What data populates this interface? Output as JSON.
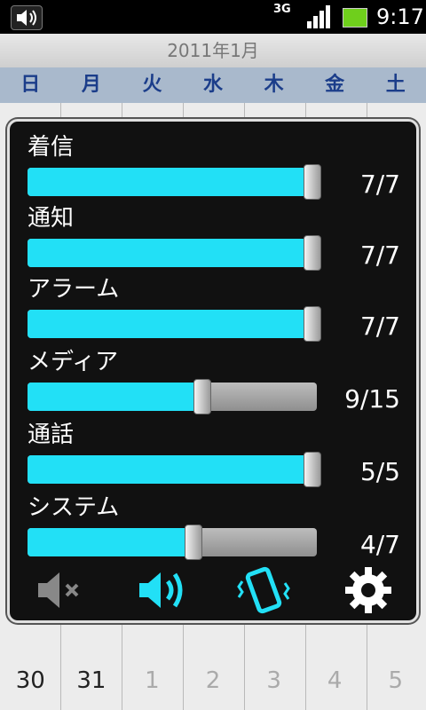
{
  "status": {
    "network": "3G",
    "time": "9:17"
  },
  "calendar": {
    "month_title": "2011年1月",
    "weekdays": [
      "日",
      "月",
      "火",
      "水",
      "木",
      "金",
      "土"
    ],
    "bottom_dates": [
      "30",
      "31",
      "1",
      "2",
      "3",
      "4",
      "5"
    ]
  },
  "volume_panel": {
    "rows": [
      {
        "label": "着信",
        "value_text": "7/7",
        "fraction": 1.0
      },
      {
        "label": "通知",
        "value_text": "7/7",
        "fraction": 1.0
      },
      {
        "label": "アラーム",
        "value_text": "7/7",
        "fraction": 1.0
      },
      {
        "label": "メディア",
        "value_text": "9/15",
        "fraction": 0.6
      },
      {
        "label": "通話",
        "value_text": "5/5",
        "fraction": 1.0
      },
      {
        "label": "システム",
        "value_text": "4/7",
        "fraction": 0.5714
      }
    ],
    "buttons": [
      {
        "icon": "mute-icon"
      },
      {
        "icon": "speaker-icon"
      },
      {
        "icon": "vibrate-icon"
      },
      {
        "icon": "gear-icon"
      }
    ],
    "accent_color": "#22e0f6"
  }
}
